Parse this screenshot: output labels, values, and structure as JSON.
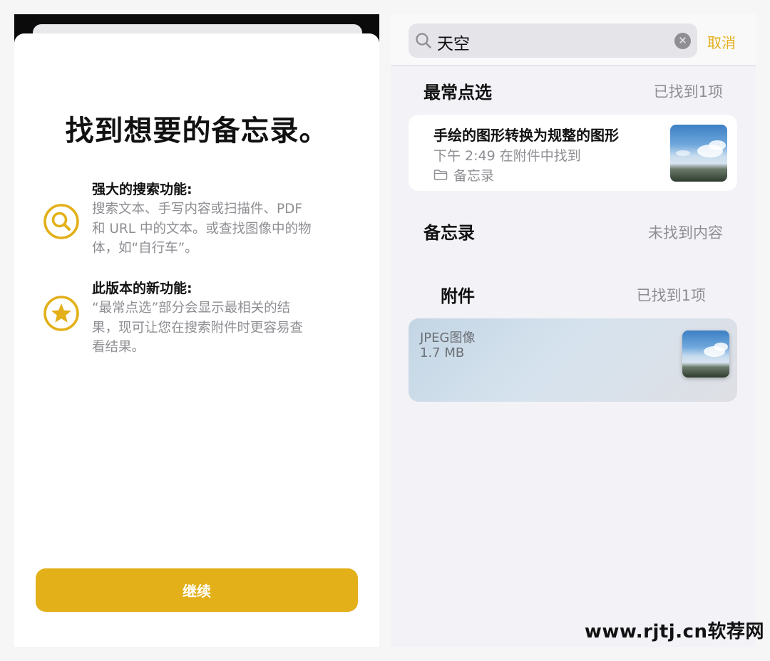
{
  "onboarding": {
    "title": "找到想要的备忘录。",
    "features": [
      {
        "icon": "search-icon",
        "heading": "强大的搜索功能:",
        "body_lines": [
          "搜索文本、手写内容或扫描件、PDF",
          "和 URL 中的文本。或查找图像中的物",
          "体，如“自行车”。"
        ]
      },
      {
        "icon": "star-icon",
        "heading": "此版本的新功能:",
        "body_lines": [
          "“最常点选”部分会显示最相关的结",
          "果，现可让您在搜索附件时更容易查",
          "看结果。"
        ]
      }
    ],
    "continue_label": "继续",
    "accent_color": "#e3b019"
  },
  "search": {
    "query": "天空",
    "cancel_label": "取消",
    "sections": {
      "top_hits": {
        "title": "最常点选",
        "count": "已找到1项",
        "result": {
          "title": "手绘的图形转换为规整的图形",
          "meta": "下午 2:49  在附件中找到",
          "folder": "备忘录"
        }
      },
      "notes": {
        "title": "备忘录",
        "count": "未找到内容"
      },
      "attachments": {
        "title": "附件",
        "count": "已找到1项",
        "item": {
          "name": "JPEG图像",
          "size": "1.7 MB"
        }
      }
    }
  },
  "watermark": "www.rjtj.cn软荐网"
}
